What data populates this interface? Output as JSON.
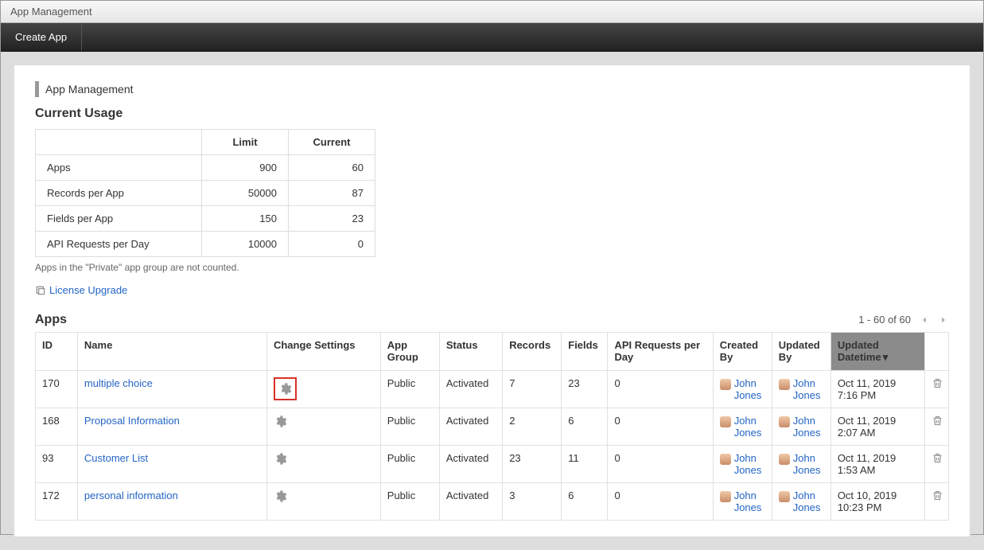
{
  "window_title": "App Management",
  "create_app_label": "Create App",
  "section_heading": "App Management",
  "usage": {
    "heading": "Current Usage",
    "head_limit": "Limit",
    "head_current": "Current",
    "rows": [
      {
        "label": "Apps",
        "limit": "900",
        "current": "60"
      },
      {
        "label": "Records per App",
        "limit": "50000",
        "current": "87"
      },
      {
        "label": "Fields per App",
        "limit": "150",
        "current": "23"
      },
      {
        "label": "API Requests per Day",
        "limit": "10000",
        "current": "0"
      }
    ],
    "note": "Apps in the \"Private\" app group are not counted."
  },
  "license_upgrade": "License Upgrade",
  "apps": {
    "heading": "Apps",
    "pager": "1 - 60 of 60",
    "headers": {
      "id": "ID",
      "name": "Name",
      "change": "Change Settings",
      "group": "App Group",
      "status": "Status",
      "records": "Records",
      "fields": "Fields",
      "api": "API Requests per Day",
      "created_by": "Created By",
      "updated_by": "Updated By",
      "updated_dt": "Updated Datetime"
    },
    "rows": [
      {
        "id": "170",
        "name": "multiple choice",
        "highlight": true,
        "group": "Public",
        "status": "Activated",
        "records": "7",
        "fields": "23",
        "api": "0",
        "created_by": "John Jones",
        "updated_by": "John Jones",
        "updated_dt": "Oct 11, 2019 7:16 PM"
      },
      {
        "id": "168",
        "name": "Proposal Information",
        "highlight": false,
        "group": "Public",
        "status": "Activated",
        "records": "2",
        "fields": "6",
        "api": "0",
        "created_by": "John Jones",
        "updated_by": "John Jones",
        "updated_dt": "Oct 11, 2019 2:07 AM"
      },
      {
        "id": "93",
        "name": "Customer List",
        "highlight": false,
        "group": "Public",
        "status": "Activated",
        "records": "23",
        "fields": "11",
        "api": "0",
        "created_by": "John Jones",
        "updated_by": "John Jones",
        "updated_dt": "Oct 11, 2019 1:53 AM"
      },
      {
        "id": "172",
        "name": "personal information",
        "highlight": false,
        "group": "Public",
        "status": "Activated",
        "records": "3",
        "fields": "6",
        "api": "0",
        "created_by": "John Jones",
        "updated_by": "John Jones",
        "updated_dt": "Oct 10, 2019 10:23 PM"
      }
    ]
  }
}
